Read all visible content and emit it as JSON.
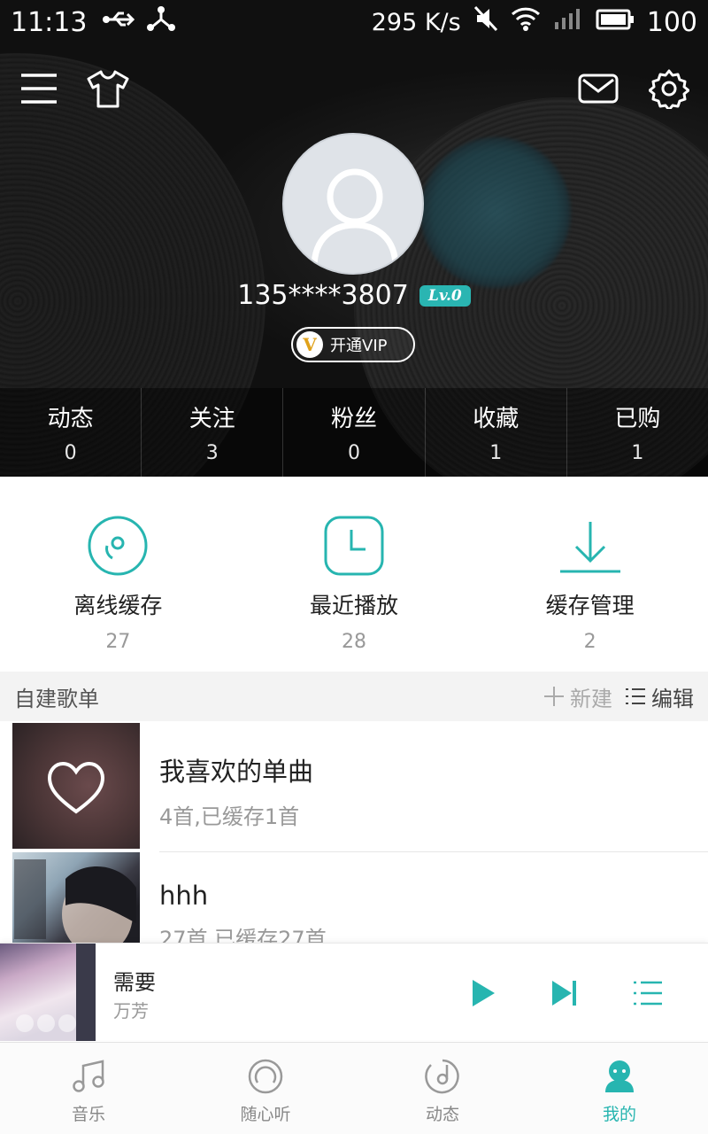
{
  "status_bar": {
    "time": "11:13",
    "speed": "295 K/s",
    "battery": "100"
  },
  "profile": {
    "username": "135****3807",
    "level": "Lv.0",
    "vip_icon_letter": "V",
    "vip_label": "开通VIP"
  },
  "stats": [
    {
      "label": "动态",
      "count": "0"
    },
    {
      "label": "关注",
      "count": "3"
    },
    {
      "label": "粉丝",
      "count": "0"
    },
    {
      "label": "收藏",
      "count": "1"
    },
    {
      "label": "已购",
      "count": "1"
    }
  ],
  "shortcuts": [
    {
      "label": "离线缓存",
      "count": "27",
      "icon": "offline-disc-icon"
    },
    {
      "label": "最近播放",
      "count": "28",
      "icon": "clock-icon"
    },
    {
      "label": "缓存管理",
      "count": "2",
      "icon": "download-icon"
    }
  ],
  "playlists_section": {
    "title": "自建歌单",
    "new_label": "新建",
    "edit_label": "编辑"
  },
  "playlists": [
    {
      "name": "我喜欢的单曲",
      "subtitle": "4首,已缓存1首"
    },
    {
      "name": "hhh",
      "subtitle": "27首,已缓存27首"
    }
  ],
  "player": {
    "song": "需要",
    "artist": "万芳"
  },
  "bottom_nav": [
    {
      "label": "音乐",
      "active": false
    },
    {
      "label": "随心听",
      "active": false
    },
    {
      "label": "动态",
      "active": false
    },
    {
      "label": "我的",
      "active": true
    }
  ],
  "colors": {
    "accent": "#27b5b0",
    "level_badge": "#2ab5b2",
    "vip_gold": "#e0a21c"
  }
}
